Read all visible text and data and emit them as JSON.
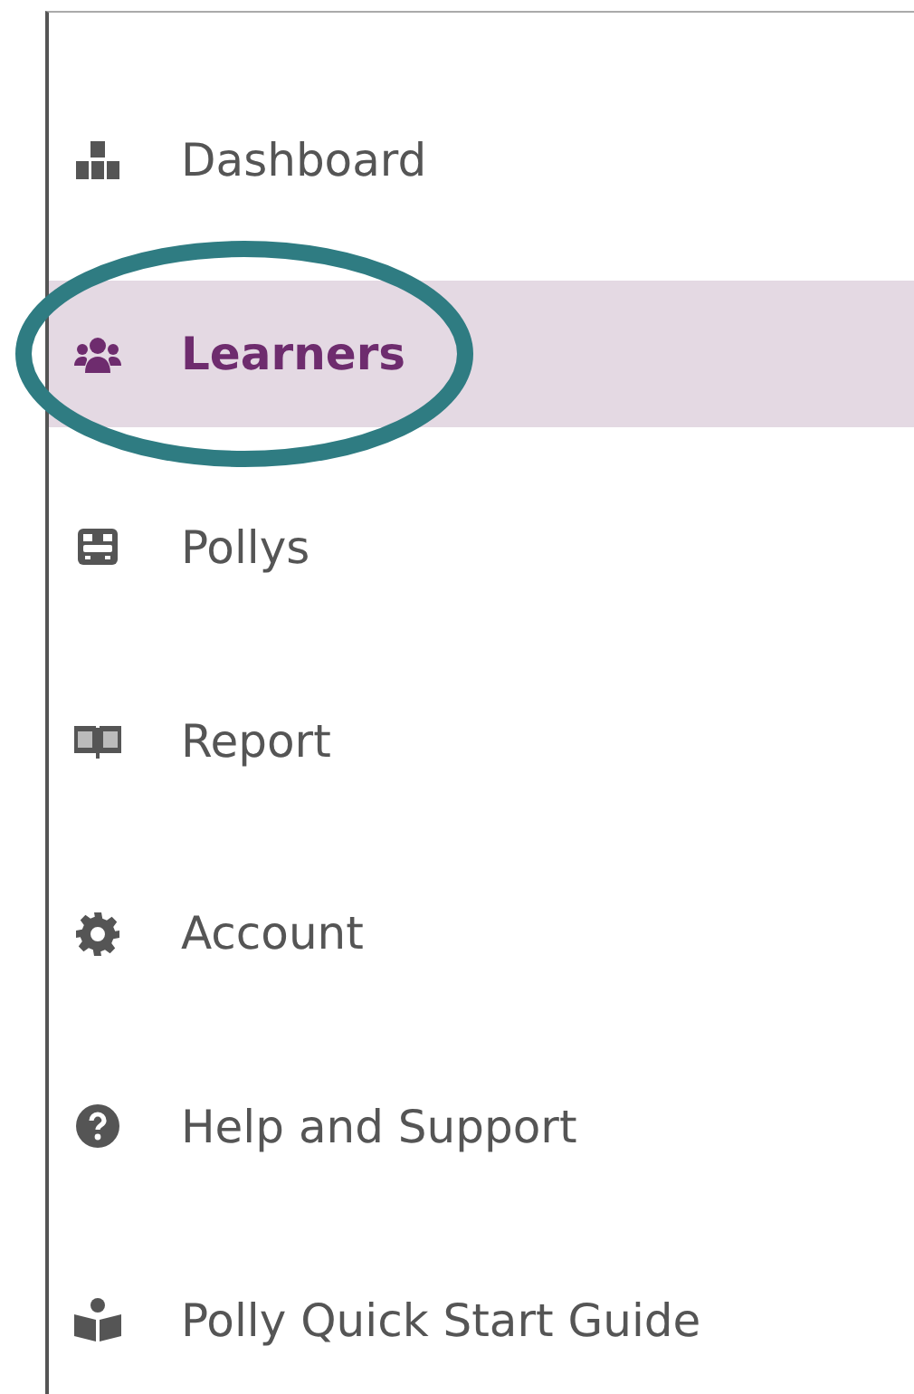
{
  "sidebar": {
    "items": [
      {
        "kind": "dashboard",
        "label": "Dashboard",
        "selected": false,
        "circled": false
      },
      {
        "kind": "learners",
        "label": "Learners",
        "selected": true,
        "circled": true
      },
      {
        "kind": "pollys",
        "label": "Pollys",
        "selected": false,
        "circled": false
      },
      {
        "kind": "report",
        "label": "Report",
        "selected": false,
        "circled": false
      },
      {
        "kind": "account",
        "label": "Account",
        "selected": false,
        "circled": false
      },
      {
        "kind": "help",
        "label": "Help and Support",
        "selected": false,
        "circled": false
      },
      {
        "kind": "guide",
        "label": "Polly Quick Start Guide",
        "selected": false,
        "circled": false
      }
    ]
  }
}
